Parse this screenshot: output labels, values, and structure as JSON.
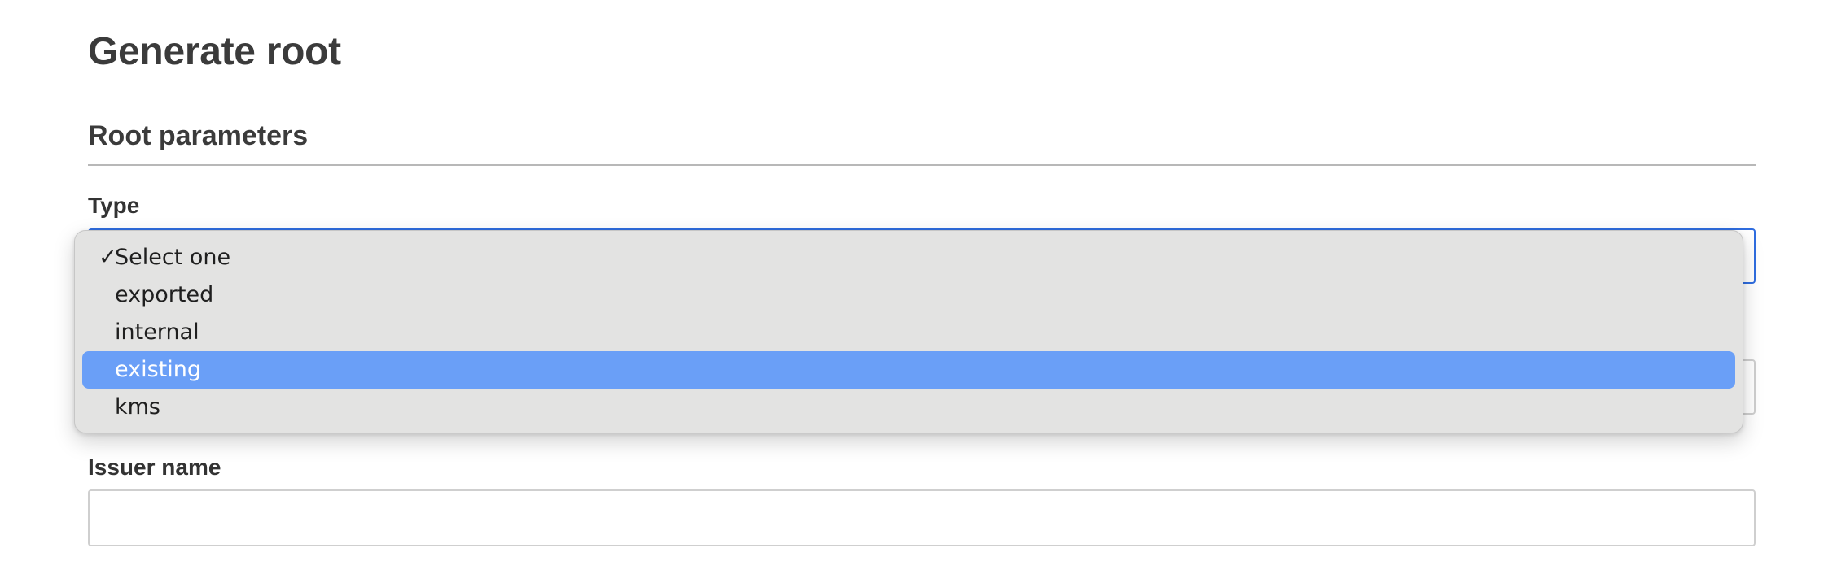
{
  "page": {
    "title": "Generate root"
  },
  "section": {
    "title": "Root parameters"
  },
  "type_field": {
    "label": "Type",
    "selected_value": "Select one",
    "options": [
      {
        "label": "Select one",
        "checked": true,
        "highlighted": false
      },
      {
        "label": "exported",
        "checked": false,
        "highlighted": false
      },
      {
        "label": "internal",
        "checked": false,
        "highlighted": false
      },
      {
        "label": "existing",
        "checked": false,
        "highlighted": true
      },
      {
        "label": "kms",
        "checked": false,
        "highlighted": false
      }
    ],
    "check_glyph": "✓"
  },
  "issuer_field": {
    "label": "Issuer name",
    "value": "",
    "placeholder": ""
  },
  "colors": {
    "focus_border": "#2f6de0",
    "highlight": "#6a9ff7",
    "menu_background": "#e3e3e2",
    "heading_text": "#3b3b3b"
  }
}
